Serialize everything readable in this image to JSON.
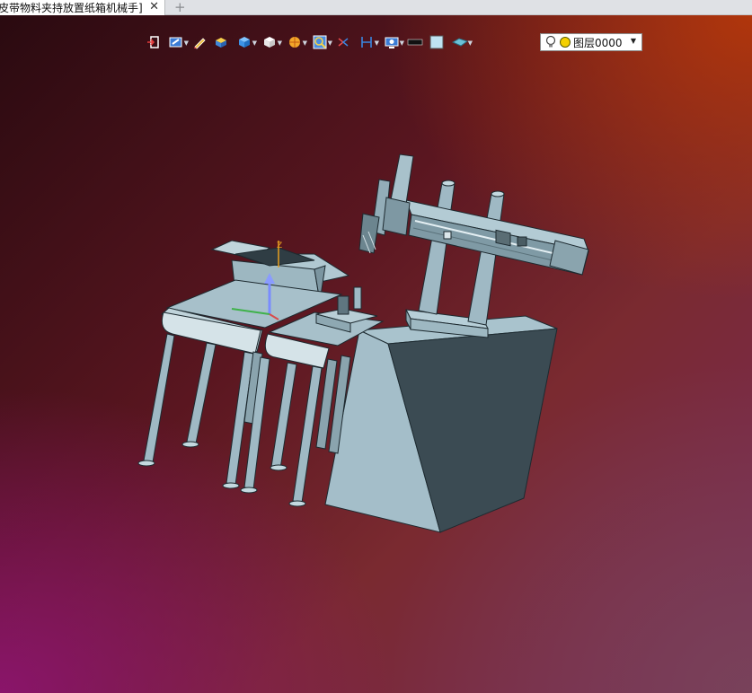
{
  "tab": {
    "title": "皮带物料夹持放置纸箱机械手]",
    "close": "✕",
    "new_tab": "+"
  },
  "toolbar": {
    "items": [
      "exit-icon",
      "view-orient-icon",
      "sketch-pen-icon",
      "solid-box-icon",
      "cube-view-icon",
      "wireframe-cube-icon",
      "render-style-icon",
      "zoom-fit-icon",
      "mirror-icon",
      "measure-icon",
      "display-settings-icon",
      "line-color-icon",
      "fill-color-icon",
      "surface-icon"
    ]
  },
  "layer": {
    "label": "图层0000",
    "bulb_color": "#f4d000"
  },
  "colors": {
    "part": "#9fb9c4",
    "part_dark": "#3a4a52",
    "part_edge": "#1d2a30"
  }
}
